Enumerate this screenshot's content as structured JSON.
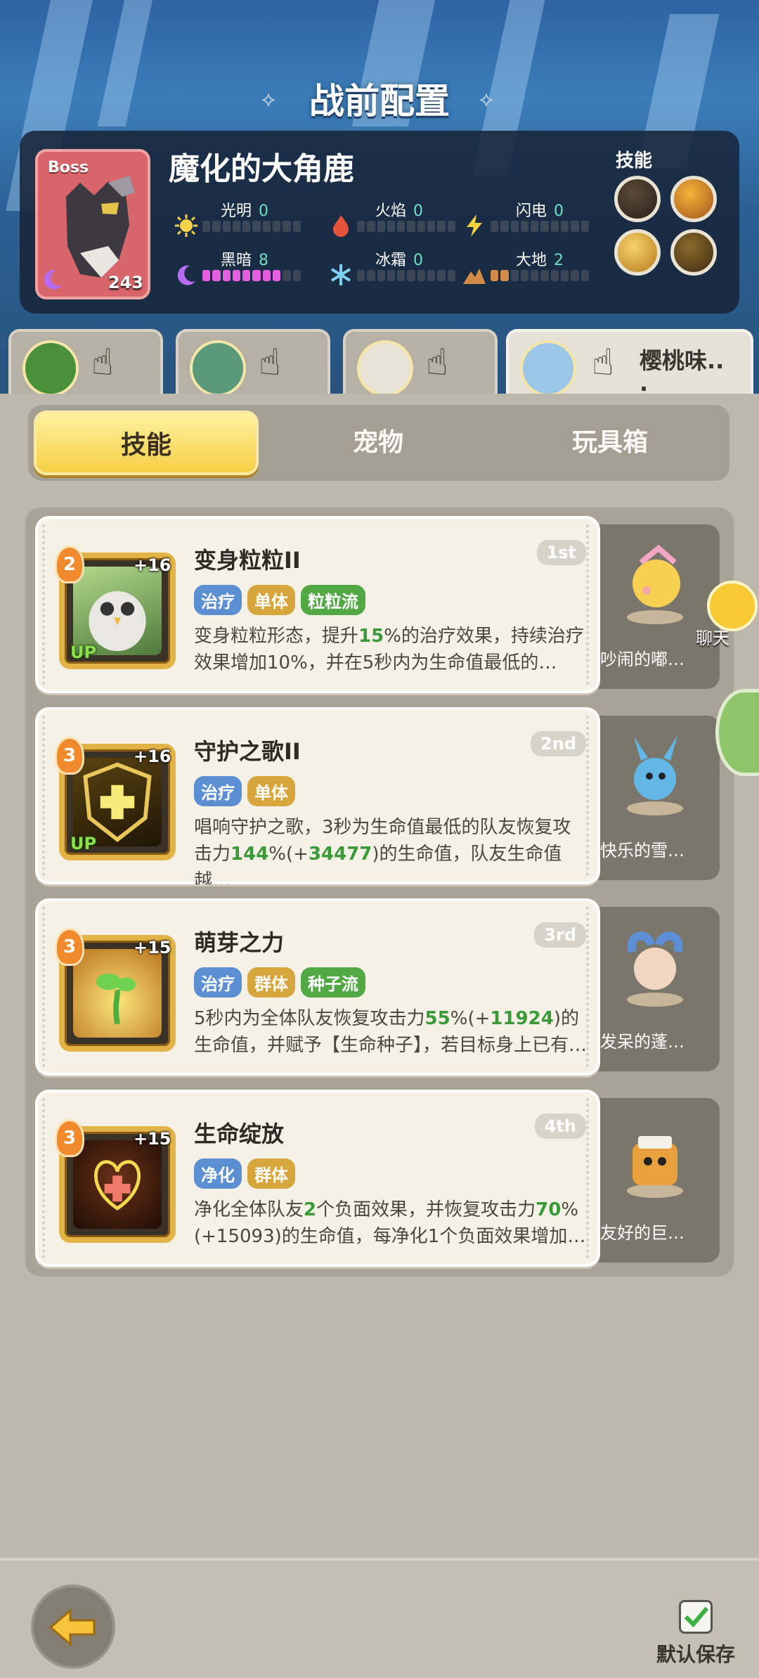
{
  "title": "战前配置",
  "boss": {
    "tag": "Boss",
    "name": "魔化的大角鹿",
    "level": "243",
    "skills_label": "技能",
    "elements": [
      {
        "label": "光明",
        "value": "0"
      },
      {
        "label": "火焰",
        "value": "0"
      },
      {
        "label": "闪电",
        "value": "0"
      },
      {
        "label": "黑暗",
        "value": "8"
      },
      {
        "label": "冰霜",
        "value": "0"
      },
      {
        "label": "大地",
        "value": "2"
      }
    ]
  },
  "party": {
    "active_name": "樱桃味..",
    "active_name_tail": "."
  },
  "segment": {
    "tabs": [
      "技能",
      "宠物",
      "玩具箱"
    ],
    "active": "技能"
  },
  "skills": [
    {
      "name": "变身粒粒II",
      "rank": "1st",
      "level": "2",
      "plus": "+16",
      "up": "UP",
      "tags": [
        "治疗",
        "单体",
        "粒粒流"
      ],
      "desc_a": "变身粒粒形态，提升",
      "desc_hl1": "15",
      "desc_b": "%的治疗效果，持续治疗效果增加10%，并在5秒内为生命值最低的…",
      "pet": "吵闹的嘟…"
    },
    {
      "name": "守护之歌II",
      "rank": "2nd",
      "level": "3",
      "plus": "+16",
      "up": "UP",
      "tags": [
        "治疗",
        "单体"
      ],
      "desc_a": "唱响守护之歌，3秒为生命值最低的队友恢复攻击力",
      "desc_hl1": "144",
      "desc_b": "%(+",
      "desc_hl2": "34477",
      "desc_c": ")的生命值，队友生命值越…",
      "pet": "快乐的雪…"
    },
    {
      "name": "萌芽之力",
      "rank": "3rd",
      "level": "3",
      "plus": "+15",
      "tags": [
        "治疗",
        "群体",
        "种子流"
      ],
      "desc_a": "5秒内为全体队友恢复攻击力",
      "desc_hl1": "55",
      "desc_b": "%(+",
      "desc_hl2": "11924",
      "desc_c": ")的生命值，并赋予【生命种子】，若目标身上已有…",
      "pet": "发呆的蓬…"
    },
    {
      "name": "生命绽放",
      "rank": "4th",
      "level": "3",
      "plus": "+15",
      "tags": [
        "净化",
        "群体"
      ],
      "desc_a": "净化全体队友",
      "desc_hl1": "2",
      "desc_b": "个负面效果，并恢复攻击力",
      "desc_hl2": "70",
      "desc_c": "%(+15093)的生命值，每净化1个负面效果增加…",
      "pet": "友好的巨…"
    }
  ],
  "chat": {
    "label": "聊天"
  },
  "footer": {
    "save_label": "默认保存"
  },
  "colors": {
    "accent_yellow": "#f6cf44",
    "highlight_green": "#3a9a3a",
    "dark_bar": "#e45ee0"
  }
}
